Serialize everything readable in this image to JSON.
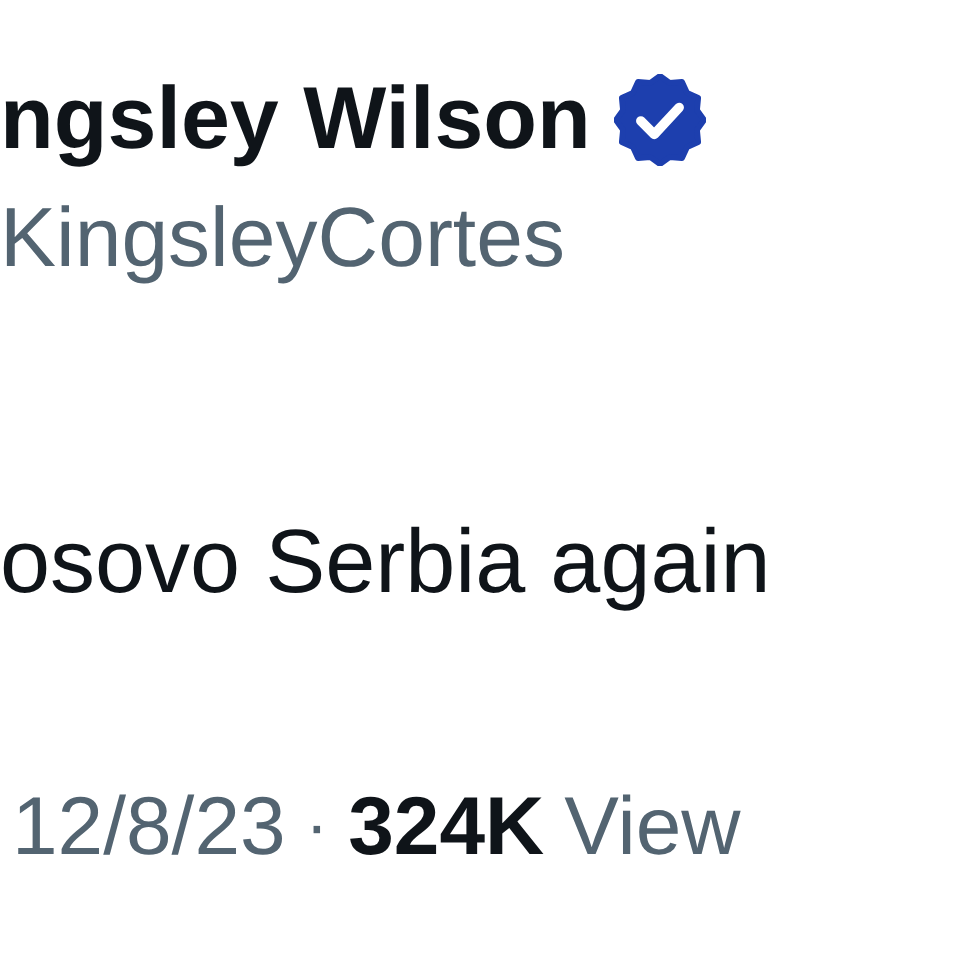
{
  "author": {
    "name": "ngsley Wilson",
    "verified": true,
    "handle": "KingsleyCortes"
  },
  "text": "osovo Serbia again",
  "meta": {
    "date": "12/8/23",
    "separator": "·",
    "views_count": "324K",
    "views_label": "View"
  }
}
